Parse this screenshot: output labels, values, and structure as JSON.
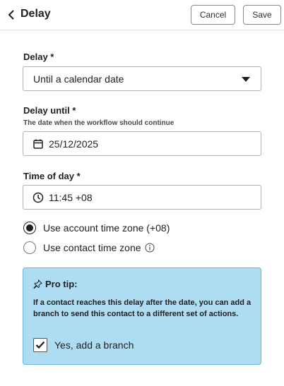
{
  "header": {
    "title": "Delay",
    "cancel_label": "Cancel",
    "save_label": "Save"
  },
  "delay": {
    "label": "Delay *",
    "selected": "Until a calendar date"
  },
  "delay_until": {
    "label": "Delay until *",
    "help": "The date when the workflow should continue",
    "value": "25/12/2025"
  },
  "time_of_day": {
    "label": "Time of day *",
    "value": "11:45 +08"
  },
  "timezone": {
    "options": [
      {
        "label": "Use account time zone (+08)",
        "selected": true
      },
      {
        "label": "Use contact time zone",
        "selected": false
      }
    ]
  },
  "pro_tip": {
    "title": "Pro tip:",
    "body": "If a contact reaches this delay after the date, you can add a branch to send this contact to a different set of actions.",
    "checkbox_label": "Yes, add a branch",
    "checked": true
  }
}
